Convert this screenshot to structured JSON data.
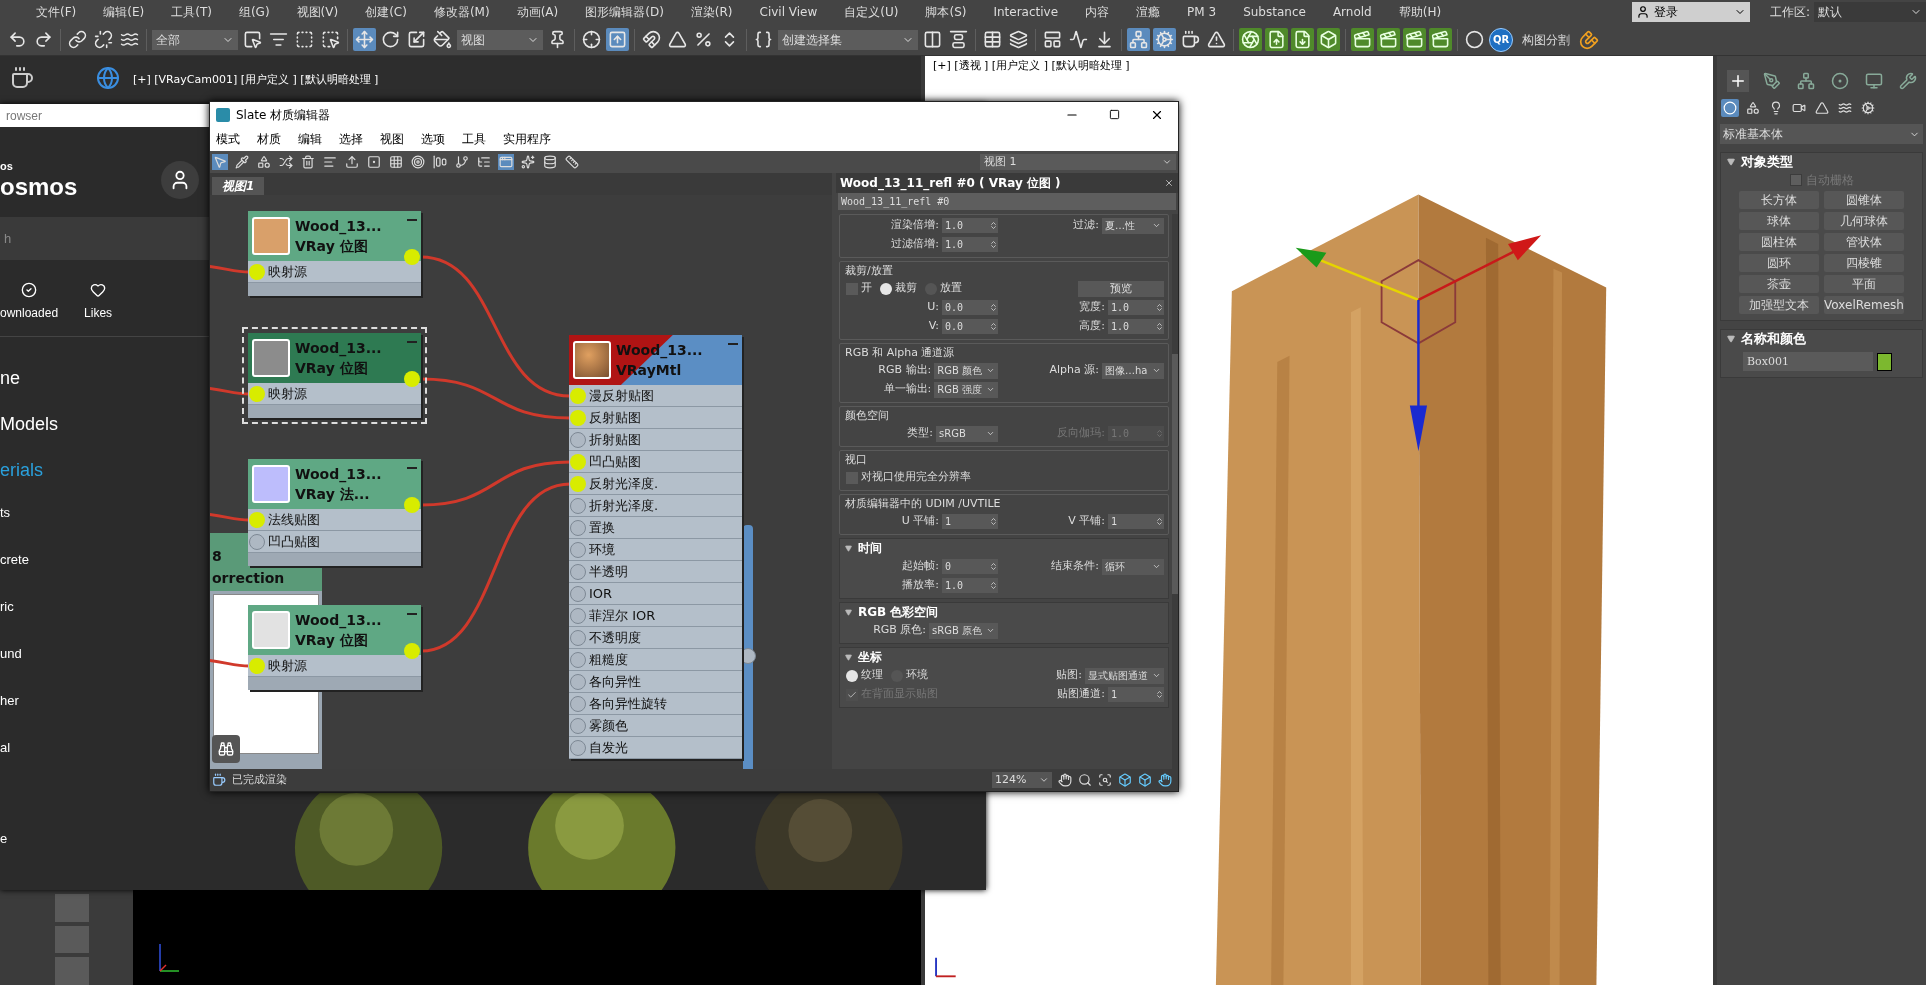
{
  "menu_bar": {
    "items": [
      "文件(F)",
      "编辑(E)",
      "工具(T)",
      "组(G)",
      "视图(V)",
      "创建(C)",
      "修改器(M)",
      "动画(A)",
      "图形编辑器(D)",
      "渲染(R)",
      "Civil View",
      "自定义(U)",
      "脚本(S)",
      "Interactive",
      "内容",
      "渲瘾",
      "PM 3",
      "Substance",
      "Arnold",
      "帮助(H)"
    ],
    "login": "登录",
    "workspace_label": "工作区:",
    "workspace": "默认"
  },
  "toolbar": {
    "selection_filter": "全部",
    "reference_coord": "视图",
    "selection_set": "创建选择集",
    "qr": "QR",
    "label": "构图分割",
    "tools": [
      {
        "on": false
      },
      {
        "on": false
      },
      {
        "on": false
      },
      {
        "on": false
      },
      {
        "on": false
      },
      {
        "on": false
      },
      {
        "on": false
      },
      {
        "on": false
      },
      {
        "on": false
      },
      {
        "on": true
      },
      {
        "on": false
      },
      {
        "on": false
      },
      {
        "on": false
      },
      {
        "on": false
      },
      {
        "on": false
      },
      {
        "on": true
      },
      {
        "on": false
      },
      {
        "on": false
      },
      {
        "on": false
      },
      {
        "on": false
      },
      {
        "on": false
      },
      {
        "on": false
      },
      {
        "on": false
      },
      {
        "on": false
      },
      {
        "on": false
      },
      {
        "on": false
      },
      {
        "on": false
      },
      {
        "on": false
      },
      {
        "on": true
      },
      {
        "on": true
      },
      {
        "on": false
      },
      {
        "on": false
      },
      {
        "on": false
      },
      {
        "on": false
      },
      {
        "on": false
      },
      {
        "on": false
      },
      {
        "on": false
      },
      {
        "on": false
      },
      {
        "on": false
      },
      {
        "on": false
      },
      {
        "on": false
      }
    ]
  },
  "viewports": [
    {
      "label": "[+] [VRayCam001] [用户定义 ] [默认明暗处理 ]"
    },
    {
      "label": "[+] [透视 ] [用户定义 ] [默认明暗处理 ]"
    }
  ],
  "command_panel": {
    "tabs": [
      {
        "selected": true
      },
      {
        "selected": false
      },
      {
        "selected": false
      },
      {
        "selected": false
      },
      {
        "selected": false
      },
      {
        "selected": false
      }
    ],
    "subtabs": [
      {
        "selected": true
      },
      {
        "selected": false
      },
      {
        "selected": false
      },
      {
        "selected": false
      },
      {
        "selected": false
      },
      {
        "selected": false
      },
      {
        "selected": false
      }
    ],
    "category": "标准基本体",
    "object_type": {
      "title": "对象类型",
      "expanded": true,
      "auto_grid": {
        "label": "自动栅格",
        "checked": false,
        "disabled": true
      },
      "buttons": [
        "长方体",
        "圆锥体",
        "球体",
        "几何球体",
        "圆柱体",
        "管状体",
        "圆环",
        "四棱锥",
        "茶壶",
        "平面",
        "加强型文本",
        "VoxelRemesh"
      ]
    },
    "name_color": {
      "title": "名称和颜色",
      "expanded": true,
      "name": "Box001",
      "color": "#7cb82f"
    }
  },
  "browser": {
    "title": "rowser",
    "brand_small": "os",
    "brand": "osmos",
    "search": {
      "placeholder": "h"
    },
    "links": [
      {
        "label": "ownloaded"
      },
      {
        "label": "Likes"
      }
    ],
    "nav": [
      {
        "label": "ne",
        "kind": "main",
        "selected": false
      },
      {
        "label": "Models",
        "kind": "main",
        "selected": false
      },
      {
        "label": "erials",
        "kind": "main",
        "selected": true
      },
      {
        "label": "ts",
        "kind": "sub",
        "selected": false
      },
      {
        "label": "crete",
        "kind": "sub",
        "selected": false
      },
      {
        "label": "ric",
        "kind": "sub",
        "selected": false
      },
      {
        "label": "und",
        "kind": "sub",
        "selected": false
      },
      {
        "label": "her",
        "kind": "sub",
        "selected": false
      },
      {
        "label": "al",
        "kind": "sub",
        "selected": false
      },
      {
        "label": "e",
        "kind": "sub",
        "selected": false
      }
    ]
  },
  "slate": {
    "title": "Slate 材质编辑器",
    "menu": [
      "模式",
      "材质",
      "编辑",
      "选择",
      "视图",
      "选项",
      "工具",
      "实用程序"
    ],
    "tools": [
      {
        "on": true
      },
      {
        "on": false
      },
      {
        "on": false
      },
      {
        "on": false
      },
      {
        "on": false
      },
      {
        "on": false
      },
      {
        "on": false
      },
      {
        "on": false
      },
      {
        "on": false
      },
      {
        "on": false
      },
      {
        "on": false
      },
      {
        "on": false
      },
      {
        "on": false
      },
      {
        "on": true
      },
      {
        "on": false
      },
      {
        "on": false
      },
      {
        "on": false
      }
    ],
    "view_select": "视图 1",
    "tabs": [
      {
        "label": "视图1",
        "selected": true
      }
    ],
    "partial_node": {
      "lines": [
        "8",
        "orrection"
      ]
    },
    "nodes": [
      {
        "title": "Wood_13...",
        "subtitle": "VRay 位图",
        "color": "#d9a06a",
        "selected": false,
        "ports": [
          {
            "label": "映射源",
            "connected": true
          }
        ]
      },
      {
        "title": "Wood_13...",
        "subtitle": "VRay 位图",
        "color": "#8c8c8c",
        "selected": true,
        "ports": [
          {
            "label": "映射源",
            "connected": true
          }
        ]
      },
      {
        "title": "Wood_13...",
        "subtitle": "VRay 法...",
        "color": "#bdbdfc",
        "selected": false,
        "ports": [
          {
            "label": "法线贴图",
            "connected": true
          },
          {
            "label": "凹凸贴图",
            "connected": false
          }
        ]
      },
      {
        "title": "Wood_13...",
        "subtitle": "VRay 位图",
        "color": "#e2e2e2",
        "selected": false,
        "ports": [
          {
            "label": "映射源",
            "connected": true
          }
        ]
      }
    ],
    "material": {
      "title": "Wood_13...",
      "subtitle": "VRayMtl",
      "ports": [
        {
          "label": "漫反射贴图",
          "connected": true
        },
        {
          "label": "反射贴图",
          "connected": true
        },
        {
          "label": "折射贴图",
          "connected": false
        },
        {
          "label": "凹凸贴图",
          "connected": true
        },
        {
          "label": "反射光泽度.",
          "connected": true
        },
        {
          "label": "折射光泽度.",
          "connected": false
        },
        {
          "label": "置换",
          "connected": false
        },
        {
          "label": "环境",
          "connected": false
        },
        {
          "label": "半透明",
          "connected": false
        },
        {
          "label": "IOR",
          "connected": false
        },
        {
          "label": "菲涅尔 IOR",
          "connected": false
        },
        {
          "label": "不透明度",
          "connected": false
        },
        {
          "label": "粗糙度",
          "connected": false
        },
        {
          "label": "各向异性",
          "connected": false
        },
        {
          "label": "各向异性旋转",
          "connected": false
        },
        {
          "label": "雾颜色",
          "connected": false
        },
        {
          "label": "自发光",
          "connected": false
        }
      ]
    },
    "params": {
      "title": "Wood_13_11_refl #0 ( VRay 位图 )",
      "name": "Wood_13_11_refl #0",
      "groups": [
        {
          "kind": "box",
          "rows": [
            {
              "left": [
                {
                  "kind": "spinner",
                  "label": "渲染倍增:",
                  "value": "1.0"
                }
              ],
              "right": [
                {
                  "kind": "dropdown",
                  "label": "过滤:",
                  "value": "夏…性"
                }
              ]
            },
            {
              "left": [
                {
                  "kind": "spinner",
                  "label": "过滤倍增:",
                  "value": "1.0"
                }
              ]
            }
          ]
        },
        {
          "kind": "box",
          "title": "裁剪/放置",
          "rows": [
            {
              "left": [
                {
                  "kind": "checkbox",
                  "label": "开",
                  "checked": false
                },
                {
                  "kind": "radio",
                  "label": "裁剪",
                  "selected": true
                },
                {
                  "kind": "radio",
                  "label": "放置",
                  "selected": false
                }
              ],
              "right": [
                {
                  "kind": "button",
                  "label": "预览"
                }
              ]
            },
            {
              "left": [
                {
                  "kind": "spinner",
                  "label": "U:",
                  "value": "0.0"
                }
              ],
              "right": [
                {
                  "kind": "spinner",
                  "label": "宽度:",
                  "value": "1.0"
                }
              ]
            },
            {
              "left": [
                {
                  "kind": "spinner",
                  "label": "V:",
                  "value": "0.0"
                }
              ],
              "right": [
                {
                  "kind": "spinner",
                  "label": "高度:",
                  "value": "1.0"
                }
              ]
            }
          ]
        },
        {
          "kind": "box",
          "title": "RGB 和 Alpha 通道源",
          "rows": [
            {
              "left": [
                {
                  "kind": "dropdown",
                  "label": "RGB 输出:",
                  "value": "RGB 颜色"
                }
              ],
              "right": [
                {
                  "kind": "dropdown",
                  "label": "Alpha 源:",
                  "value": "图像…ha"
                }
              ]
            },
            {
              "left": [
                {
                  "kind": "dropdown",
                  "label": "单一输出:",
                  "value": "RGB 强度"
                }
              ]
            }
          ]
        },
        {
          "kind": "box",
          "title": "颜色空间",
          "rows": [
            {
              "left": [
                {
                  "kind": "dropdown",
                  "label": "类型:",
                  "value": "sRGB"
                }
              ],
              "right": [
                {
                  "kind": "spinner",
                  "label": "反向伽玛:",
                  "value": "1.0",
                  "disabled": true
                }
              ]
            }
          ]
        },
        {
          "kind": "box",
          "title": "视口",
          "rows": [
            {
              "left": [
                {
                  "kind": "checkbox",
                  "label": "对视口使用完全分辨率",
                  "checked": false
                }
              ]
            }
          ]
        },
        {
          "kind": "box",
          "title": "材质编辑器中的 UDIM /UVTILE",
          "rows": [
            {
              "left": [
                {
                  "kind": "spinner",
                  "label": "U 平铺:",
                  "value": "1"
                }
              ],
              "right": [
                {
                  "kind": "spinner",
                  "label": "V 平铺:",
                  "value": "1"
                }
              ]
            }
          ]
        },
        {
          "kind": "rollout",
          "title": "时间",
          "expanded": true,
          "rows": [
            {
              "left": [
                {
                  "kind": "spinner",
                  "label": "起始帧:",
                  "value": "0"
                }
              ],
              "right": [
                {
                  "kind": "dropdown",
                  "label": "结束条件:",
                  "value": "循环"
                }
              ]
            },
            {
              "left": [
                {
                  "kind": "spinner",
                  "label": "播放率:",
                  "value": "1.0"
                }
              ]
            }
          ]
        },
        {
          "kind": "rollout",
          "title": "RGB 色彩空间",
          "expanded": true,
          "rows": [
            {
              "left": [
                {
                  "kind": "dropdown",
                  "label": "RGB 原色:",
                  "value": "sRGB 原色"
                }
              ]
            }
          ]
        },
        {
          "kind": "rollout",
          "title": "坐标",
          "expanded": true,
          "rows": [
            {
              "left": [
                {
                  "kind": "radio",
                  "label": "纹理",
                  "selected": true
                },
                {
                  "kind": "radio",
                  "label": "环境",
                  "selected": false
                }
              ],
              "right": [
                {
                  "kind": "dropdown",
                  "label": "贴图:",
                  "value": "显式贴图通道"
                }
              ]
            },
            {
              "left": [
                {
                  "kind": "checkbox",
                  "label": "在背面显示贴图",
                  "checked": true,
                  "disabled": true
                }
              ],
              "right": [
                {
                  "kind": "spinner",
                  "label": "贴图通道:",
                  "value": "1"
                }
              ]
            }
          ]
        }
      ]
    },
    "status": "已完成渲染",
    "zoom": "124%"
  }
}
